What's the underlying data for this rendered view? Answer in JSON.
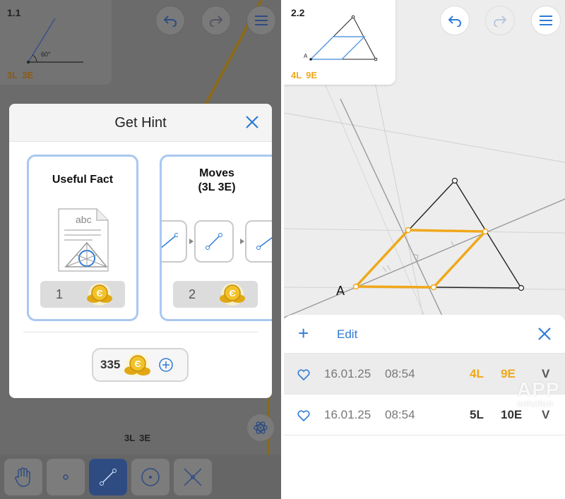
{
  "left": {
    "level_id": "1.1",
    "angle_label": "60°",
    "score_lines": "3L",
    "score_euclid": "3E",
    "bottom_score_lines": "3L",
    "bottom_score_euclid": "3E",
    "hint_modal": {
      "title": "Get Hint",
      "useful_fact": {
        "title": "Useful Fact",
        "doc_text": "abc",
        "cost": "1"
      },
      "moves": {
        "title_line1": "Moves",
        "title_line2": "(3L 3E)",
        "cost": "2"
      },
      "coins": "335",
      "coin_symbol": "Є"
    },
    "tools": [
      "hand-tool",
      "point-tool",
      "line-tool",
      "circle-tool",
      "intersect-tool"
    ]
  },
  "right": {
    "level_id": "2.2",
    "thumb_point_label": "A",
    "score_lines": "4L",
    "score_euclid": "9E",
    "point_label": "A",
    "sheet": {
      "add_label": "+",
      "edit_label": "Edit",
      "rows": [
        {
          "date": "16.01.25",
          "time": "08:54",
          "lines": "4L",
          "euclid": "9E",
          "v": "V",
          "selected": true
        },
        {
          "date": "16.01.25",
          "time": "08:54",
          "lines": "5L",
          "euclid": "10E",
          "v": "V",
          "selected": false
        }
      ]
    },
    "watermark_top": "APP",
    "watermark_bottom": "solution"
  },
  "colors": {
    "accent_blue": "#2e7bd6",
    "highlight_orange": "#f0a81b",
    "card_border": "#a9c8ef"
  }
}
